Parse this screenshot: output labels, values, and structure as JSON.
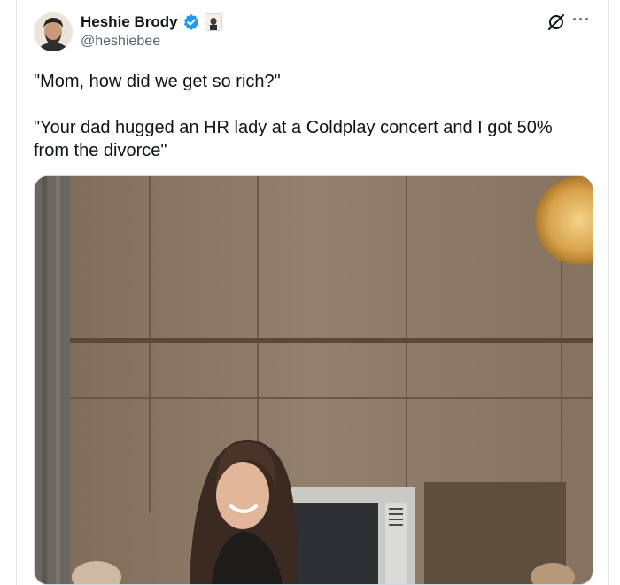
{
  "author": {
    "name": "Heshie Brody",
    "handle": "@heshiebee",
    "verified": true
  },
  "tweet": {
    "lines": [
      "\"Mom, how did we get so rich?\"",
      "\"Your dad hugged an HR lady at a Coldplay concert and I got 50% from the divorce\""
    ]
  },
  "actions": {
    "more_label": "···"
  },
  "icons": {
    "verified": "verified-badge-icon",
    "affiliate": "affiliate-badge-icon",
    "grok": "grok-icon",
    "more": "more-options-icon"
  },
  "colors": {
    "verified_blue": "#1d9bf0",
    "secondary_text": "#536471",
    "primary_text": "#0f1419",
    "border": "#e7e9ea"
  }
}
